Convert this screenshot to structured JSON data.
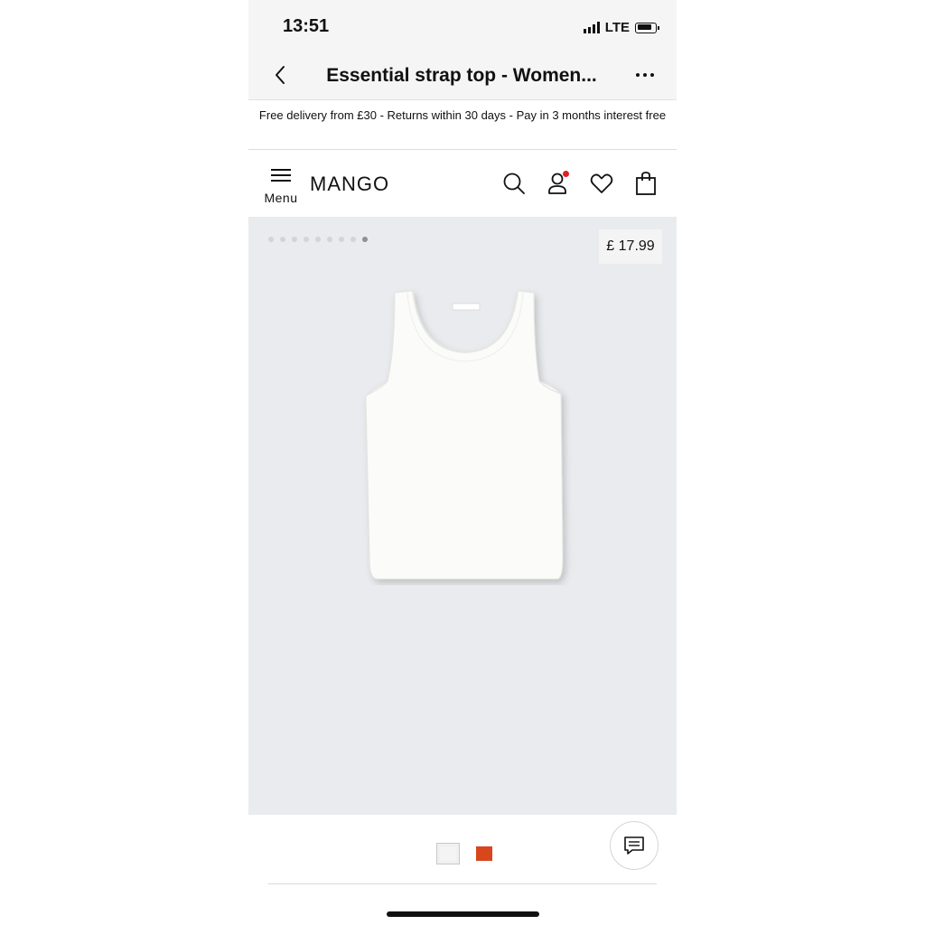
{
  "status_bar": {
    "time": "13:51",
    "network": "LTE",
    "signal_icon": "cellular-signal-icon",
    "battery_icon": "battery-icon"
  },
  "nav": {
    "title": "Essential strap top - Women...",
    "back_icon": "chevron-left-icon",
    "more_icon": "more-dots-icon"
  },
  "promo": {
    "text": "Free delivery from £30 - Returns within 30 days - Pay in 3 months interest free"
  },
  "header": {
    "menu_label": "Menu",
    "menu_icon": "hamburger-icon",
    "logo": "MANGO",
    "icons": [
      "search-icon",
      "account-icon",
      "heart-icon",
      "shopping-bag-icon"
    ],
    "notification_color": "#e02020"
  },
  "gallery": {
    "price": "£ 17.99",
    "total_images": 9,
    "active_image": 9,
    "background": "#e9ebee"
  },
  "product": {
    "image": "white-tank-top"
  },
  "colors": {
    "swatches": [
      "#f4f4f4",
      "#d8461c"
    ],
    "selected": 0
  },
  "chat": {
    "icon": "chat-icon"
  }
}
